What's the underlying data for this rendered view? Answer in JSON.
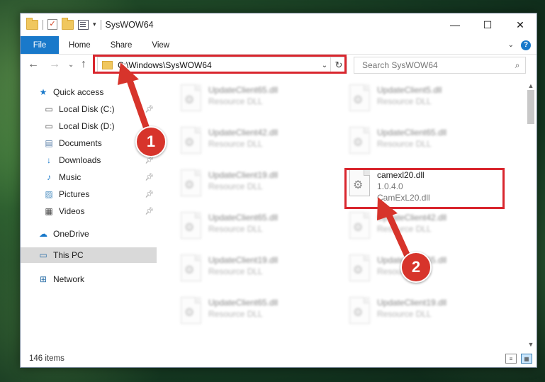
{
  "window": {
    "title": "SysWOW64",
    "caption": {
      "minimize": "—",
      "maximize": "☐",
      "close": "✕"
    }
  },
  "ribbon": {
    "tabs": [
      {
        "label": "File"
      },
      {
        "label": "Home"
      },
      {
        "label": "Share"
      },
      {
        "label": "View"
      }
    ],
    "help_label": "?"
  },
  "navigation": {
    "address": "C:\\Windows\\SysWOW64",
    "search_placeholder": "Search SysWOW64"
  },
  "sidebar": {
    "items": [
      {
        "label": "Quick access",
        "icon": "star-icon"
      },
      {
        "label": "Local Disk (C:)",
        "icon": "drive-icon"
      },
      {
        "label": "Local Disk (D:)",
        "icon": "drive-icon"
      },
      {
        "label": "Documents",
        "icon": "documents-icon"
      },
      {
        "label": "Downloads",
        "icon": "download-icon"
      },
      {
        "label": "Music",
        "icon": "music-icon"
      },
      {
        "label": "Pictures",
        "icon": "pictures-icon"
      },
      {
        "label": "Videos",
        "icon": "videos-icon"
      },
      {
        "label": "OneDrive",
        "icon": "cloud-icon"
      },
      {
        "label": "This PC",
        "icon": "computer-icon",
        "selected": true
      },
      {
        "label": "Network",
        "icon": "network-icon"
      }
    ]
  },
  "files": [
    {
      "name": "UpdateClient65.dll",
      "sub": "Resource DLL"
    },
    {
      "name": "UpdateClient5.dll",
      "sub": "Resource DLL"
    },
    {
      "name": "UpdateClient42.dll",
      "sub": "Resource DLL"
    },
    {
      "name": "UpdateClient65.dll",
      "sub": "Resource DLL"
    },
    {
      "name": "UpdateClient19.dll",
      "sub": "Resource DLL"
    },
    {
      "name": "camexl20.dll",
      "version": "1.0.4.0",
      "sub": "CamExL20.dll",
      "highlighted": true
    },
    {
      "name": "UpdateClient65.dll",
      "sub": "Resource DLL"
    },
    {
      "name": "UpdateClient42.dll",
      "sub": "Resource DLL"
    },
    {
      "name": "UpdateClient19.dll",
      "sub": "Resource DLL"
    },
    {
      "name": "UpdateClient65.dll",
      "sub": "Resource DLL"
    },
    {
      "name": "UpdateClient65.dll",
      "sub": "Resource DLL"
    },
    {
      "name": "UpdateClient19.dll",
      "sub": "Resource DLL"
    }
  ],
  "status": {
    "item_count": "146 items"
  },
  "annotations": {
    "marker1": "1",
    "marker2": "2",
    "color": "#d9262e"
  }
}
